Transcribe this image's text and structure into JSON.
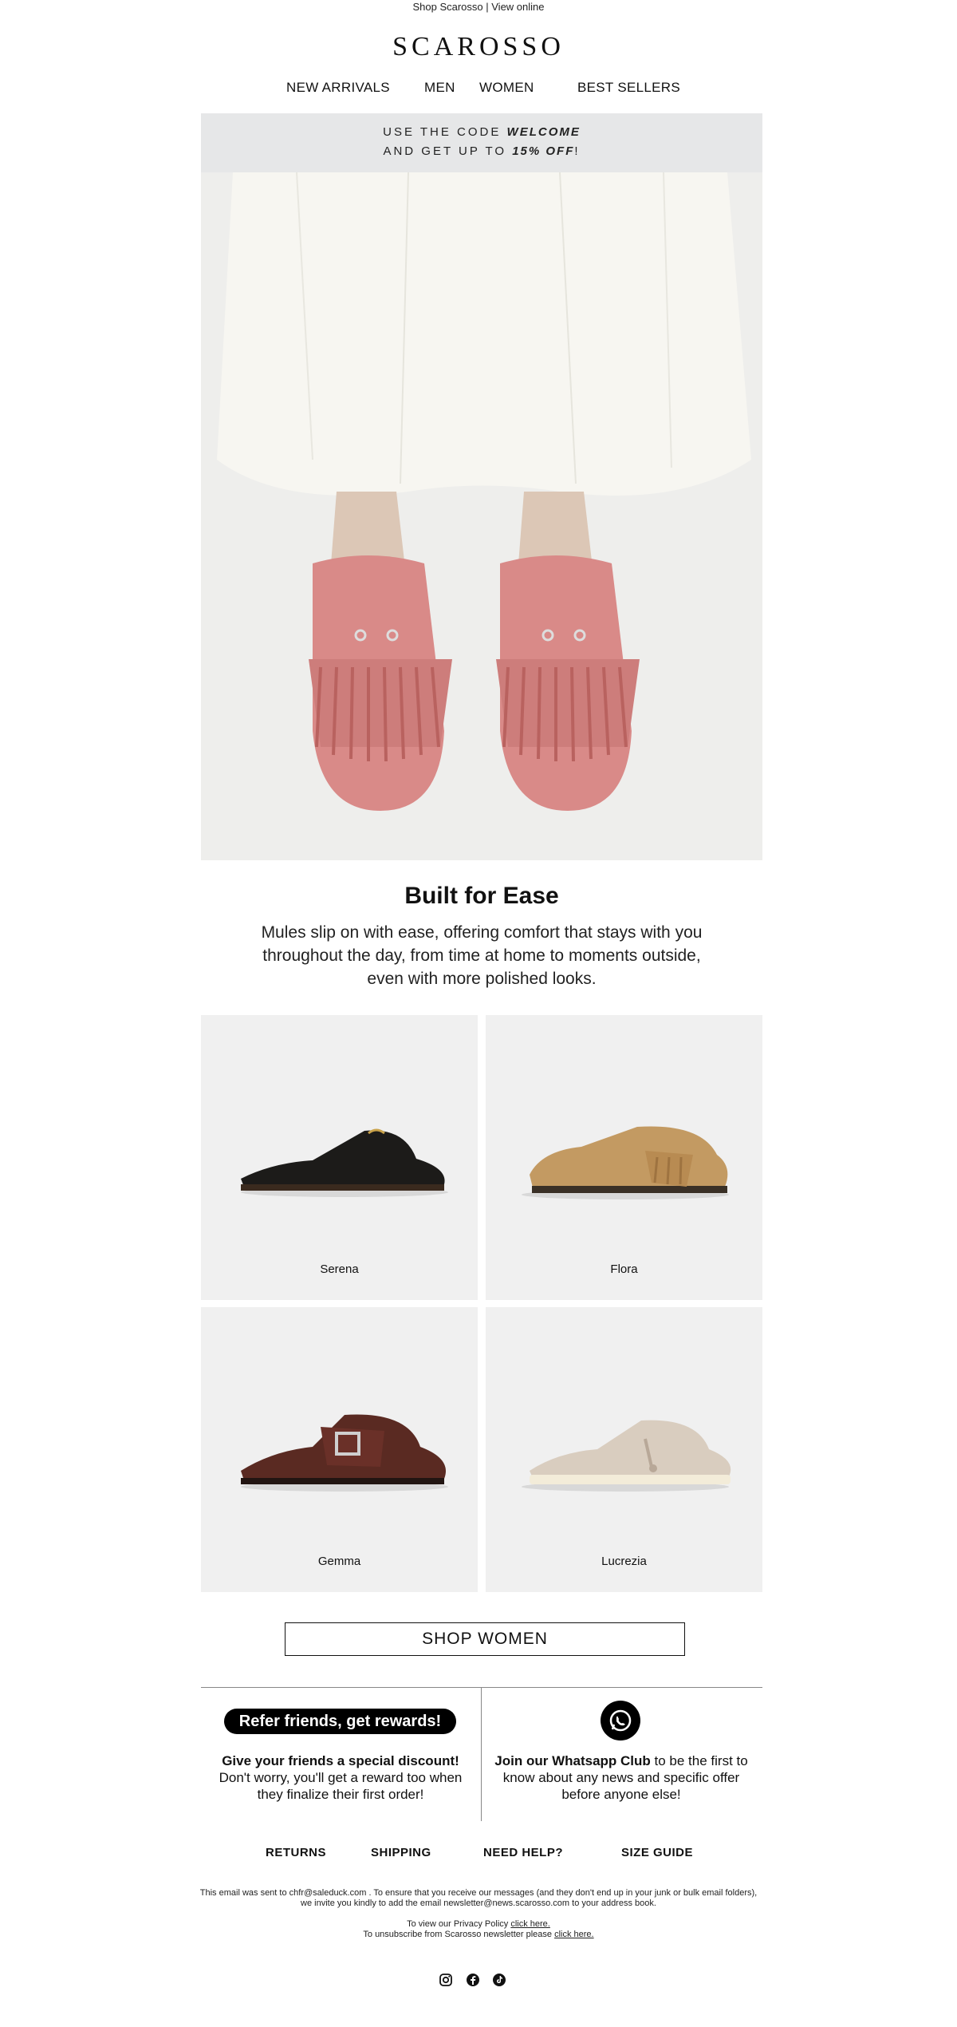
{
  "topbar": {
    "shop": "Shop Scarosso",
    "sep": " | ",
    "view": "View online"
  },
  "brand": {
    "logo": "SCAROSSO"
  },
  "nav": {
    "new_arrivals": "NEW ARRIVALS",
    "men": "MEN",
    "women": "WOMEN",
    "best_sellers": "BEST SELLERS"
  },
  "promo": {
    "line1_prefix": "USE THE CODE ",
    "code": "WELCOME",
    "line2_prefix": "AND GET UP TO ",
    "discount": "15% OFF",
    "line2_suffix": "!"
  },
  "hero": {
    "image": "woman-wearing-pink-fringed-suede-mules"
  },
  "section": {
    "title": "Built for Ease",
    "body": "Mules slip on with ease, offering comfort that stays with you throughout the day, from time at home to moments outside, even with more polished looks."
  },
  "products": [
    {
      "name": "Serena",
      "color": "#1c1b19"
    },
    {
      "name": "Flora",
      "color": "#c39a62"
    },
    {
      "name": "Gemma",
      "color": "#5a2a22"
    },
    {
      "name": "Lucrezia",
      "color": "#d9cdbf"
    }
  ],
  "cta": {
    "shop_women": "SHOP WOMEN"
  },
  "refer": {
    "pill": "Refer friends, get rewards!",
    "bold": "Give your friends a special discount!",
    "text": "Don't worry, you'll get a reward too when they finalize their first order!"
  },
  "whatsapp": {
    "icon": "whatsapp-icon",
    "bold": "Join our Whatsapp Club",
    "text": " to be the first to know about any news and specific offer before anyone else!"
  },
  "footer": {
    "returns": "RETURNS",
    "shipping": "SHIPPING",
    "need_help": "NEED HELP?",
    "size_guide": "SIZE GUIDE",
    "legal1": "This email was sent to chfr@saleduck.com . To ensure that you receive our messages (and they don't end up in your junk or bulk email folders),",
    "legal2": "we invite you kindly to add the email newsletter@news.scarosso.com to your address book.",
    "privacy_prefix": "To view our Privacy Policy ",
    "privacy_link": "click here.",
    "unsub_prefix": "To unsubscribe from Scarosso newsletter please ",
    "unsub_link": "click here."
  },
  "social": [
    "instagram-icon",
    "facebook-icon",
    "tiktok-icon"
  ]
}
